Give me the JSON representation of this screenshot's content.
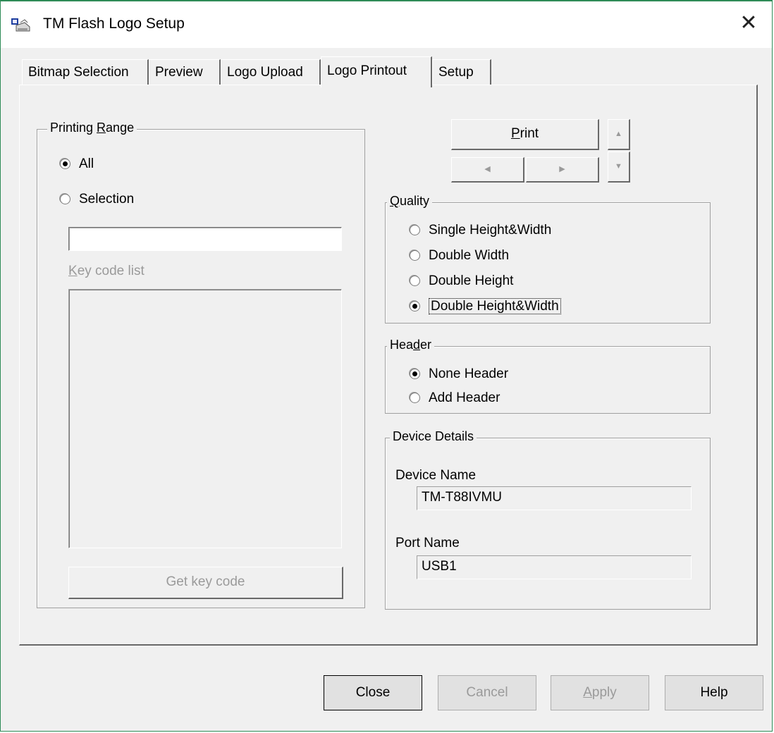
{
  "window": {
    "title": "TM Flash Logo Setup",
    "close_glyph": "✕"
  },
  "tabs": [
    {
      "label": "Bitmap Selection"
    },
    {
      "label": "Preview"
    },
    {
      "label": "Logo Upload"
    },
    {
      "label": "Logo Printout",
      "active": true
    },
    {
      "label": "Setup"
    }
  ],
  "printing_range": {
    "legend_pre": "Printing ",
    "legend_accel": "R",
    "legend_post": "ange",
    "option_all": "All",
    "option_selection": "Selection",
    "selected": "All",
    "selection_input_value": "",
    "key_code_list_accel": "K",
    "key_code_list_rest": "ey code list",
    "get_key_code": "Get key code"
  },
  "print_controls": {
    "print_accel": "P",
    "print_rest": "rint",
    "up_glyph": "▲",
    "down_glyph": "▼",
    "left_glyph": "◀",
    "right_glyph": "▶"
  },
  "quality": {
    "legend_accel": "Q",
    "legend_rest": "uality",
    "options": [
      "Single Height&Width",
      "Double Width",
      "Double Height",
      "Double Height&Width"
    ],
    "selected": "Double Height&Width"
  },
  "header": {
    "legend_pre": "Hea",
    "legend_accel": "d",
    "legend_post": "er",
    "options": [
      "None Header",
      "Add Header"
    ],
    "selected": "None Header"
  },
  "device_details": {
    "legend": "Device Details",
    "device_name_label": "Device Name",
    "device_name_value": "TM-T88IVMU",
    "port_name_label": "Port Name",
    "port_name_value": "USB1"
  },
  "footer": {
    "close": "Close",
    "cancel": "Cancel",
    "apply_accel": "A",
    "apply_rest": "pply",
    "help": "Help"
  },
  "colors": {
    "window_bg": "#f0f0f0",
    "frame_accent": "#2e8b57",
    "disabled_text": "#9a9a9a"
  }
}
